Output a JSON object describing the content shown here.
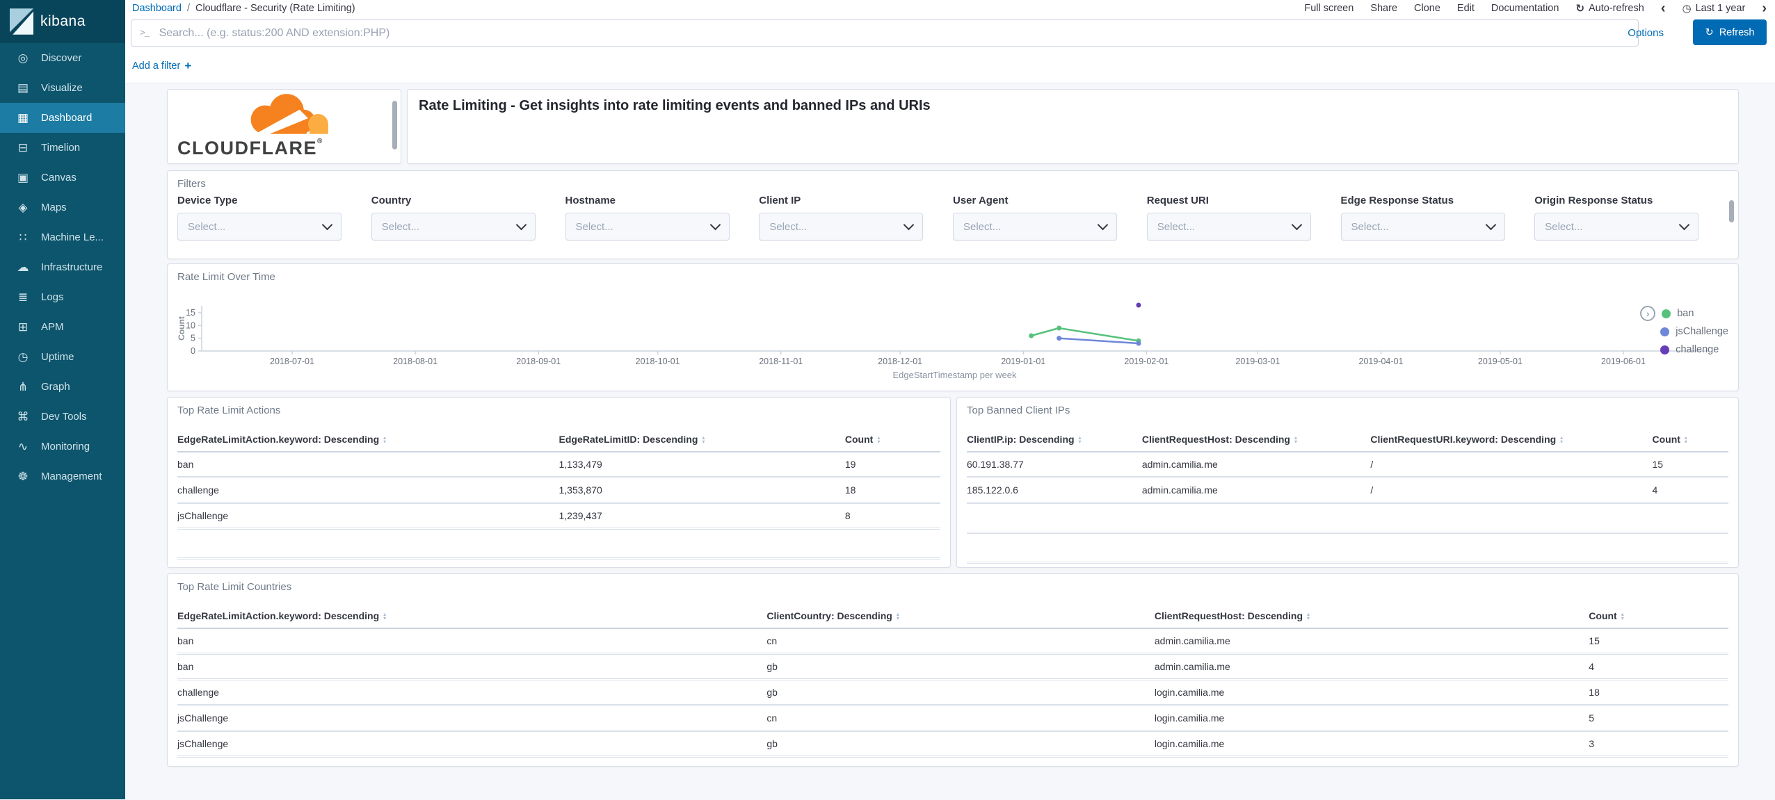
{
  "colors": {
    "accent": "#006bb4",
    "sidebar_bg": "#0d556c",
    "sidebar_active_bg": "#1d7ca3",
    "cloudflare_orange": "#f6821f",
    "cloudflare_orange_light": "#fbad41"
  },
  "sidebar": {
    "logo_text": "kibana",
    "items": [
      {
        "label": "Discover",
        "icon": "compass-icon",
        "glyph": "◎"
      },
      {
        "label": "Visualize",
        "icon": "visualize-chart-icon",
        "glyph": "▤"
      },
      {
        "label": "Dashboard",
        "icon": "dashboard-icon",
        "glyph": "▦",
        "active": true
      },
      {
        "label": "Timelion",
        "icon": "timelion-icon",
        "glyph": "⊟"
      },
      {
        "label": "Canvas",
        "icon": "canvas-icon",
        "glyph": "▣"
      },
      {
        "label": "Maps",
        "icon": "maps-icon",
        "glyph": "◈"
      },
      {
        "label": "Machine Le...",
        "icon": "machine-learning-icon",
        "glyph": "∷"
      },
      {
        "label": "Infrastructure",
        "icon": "infrastructure-cloud-icon",
        "glyph": "☁"
      },
      {
        "label": "Logs",
        "icon": "logs-icon",
        "glyph": "≣"
      },
      {
        "label": "APM",
        "icon": "apm-icon",
        "glyph": "⊞"
      },
      {
        "label": "Uptime",
        "icon": "uptime-clock-icon",
        "glyph": "◷"
      },
      {
        "label": "Graph",
        "icon": "graph-icon",
        "glyph": "⋔"
      },
      {
        "label": "Dev Tools",
        "icon": "dev-tools-icon",
        "glyph": "⌘"
      },
      {
        "label": "Monitoring",
        "icon": "monitoring-pulse-icon",
        "glyph": "∿"
      },
      {
        "label": "Management",
        "icon": "management-gear-icon",
        "glyph": "☸"
      }
    ]
  },
  "topnav": {
    "breadcrumb_root": "Dashboard",
    "breadcrumb_sep": "/",
    "breadcrumb_current": "Cloudflare - Security (Rate Limiting)",
    "actions": [
      "Full screen",
      "Share",
      "Clone",
      "Edit",
      "Documentation"
    ],
    "auto_refresh_label": "Auto-refresh",
    "time_range_label": "Last 1 year"
  },
  "search": {
    "placeholder": "Search... (e.g. status:200 AND extension:PHP)",
    "options_label": "Options",
    "refresh_label": "Refresh"
  },
  "filter_bar": {
    "add_filter_label": "Add a filter"
  },
  "logo_panel": {
    "brand": "CLOUDFLARE",
    "registered": "®"
  },
  "description_panel": {
    "text": "Rate Limiting - Get insights into rate limiting events and banned IPs and URIs"
  },
  "filters_panel": {
    "title": "Filters",
    "select_placeholder": "Select...",
    "fields": [
      "Device Type",
      "Country",
      "Hostname",
      "Client IP",
      "User Agent",
      "Request URI",
      "Edge Response Status",
      "Origin Response Status"
    ]
  },
  "tables": [
    {
      "id": "actions",
      "title": "Top Rate Limit Actions",
      "headers": [
        "EdgeRateLimitAction.keyword: Descending",
        "EdgeRateLimitID: Descending",
        "Count"
      ],
      "rows": [
        [
          "ban",
          "1,133,479",
          "19"
        ],
        [
          "challenge",
          "1,353,870",
          "18"
        ],
        [
          "jsChallenge",
          "1,239,437",
          "8"
        ]
      ]
    },
    {
      "id": "banned-ips",
      "title": "Top Banned Client IPs",
      "headers": [
        "ClientIP.ip: Descending",
        "ClientRequestHost: Descending",
        "ClientRequestURI.keyword: Descending",
        "Count"
      ],
      "rows": [
        [
          "60.191.38.77",
          "admin.camilia.me",
          "/",
          "15"
        ],
        [
          "185.122.0.6",
          "admin.camilia.me",
          "/",
          "4"
        ]
      ]
    },
    {
      "id": "countries",
      "title": "Top Rate Limit Countries",
      "headers": [
        "EdgeRateLimitAction.keyword: Descending",
        "ClientCountry: Descending",
        "ClientRequestHost: Descending",
        "Count"
      ],
      "rows": [
        [
          "ban",
          "cn",
          "admin.camilia.me",
          "15"
        ],
        [
          "ban",
          "gb",
          "admin.camilia.me",
          "4"
        ],
        [
          "challenge",
          "gb",
          "login.camilia.me",
          "18"
        ],
        [
          "jsChallenge",
          "cn",
          "login.camilia.me",
          "5"
        ],
        [
          "jsChallenge",
          "gb",
          "login.camilia.me",
          "3"
        ]
      ]
    }
  ],
  "chart_data": {
    "type": "line",
    "title": "Rate Limit Over Time",
    "xlabel": "EdgeStartTimestamp per week",
    "ylabel": "Count",
    "ylim": [
      0,
      15
    ],
    "yticks": [
      0,
      5,
      10,
      15
    ],
    "xticks": [
      "2018-07-01",
      "2018-08-01",
      "2018-09-01",
      "2018-10-01",
      "2018-11-01",
      "2018-12-01",
      "2019-01-01",
      "2019-02-01",
      "2019-03-01",
      "2019-04-01",
      "2019-05-01",
      "2019-06-01"
    ],
    "grid": false,
    "legend_position": "right",
    "series": [
      {
        "name": "ban",
        "color": "#57c17b",
        "points": [
          [
            "2019-01-03",
            6
          ],
          [
            "2019-01-10",
            9
          ],
          [
            "2019-01-30",
            4
          ]
        ]
      },
      {
        "name": "jsChallenge",
        "color": "#6f87d8",
        "points": [
          [
            "2019-01-10",
            5
          ],
          [
            "2019-01-30",
            3
          ]
        ]
      },
      {
        "name": "challenge",
        "color": "#663db8",
        "points": [
          [
            "2019-01-30",
            18
          ]
        ]
      }
    ]
  }
}
